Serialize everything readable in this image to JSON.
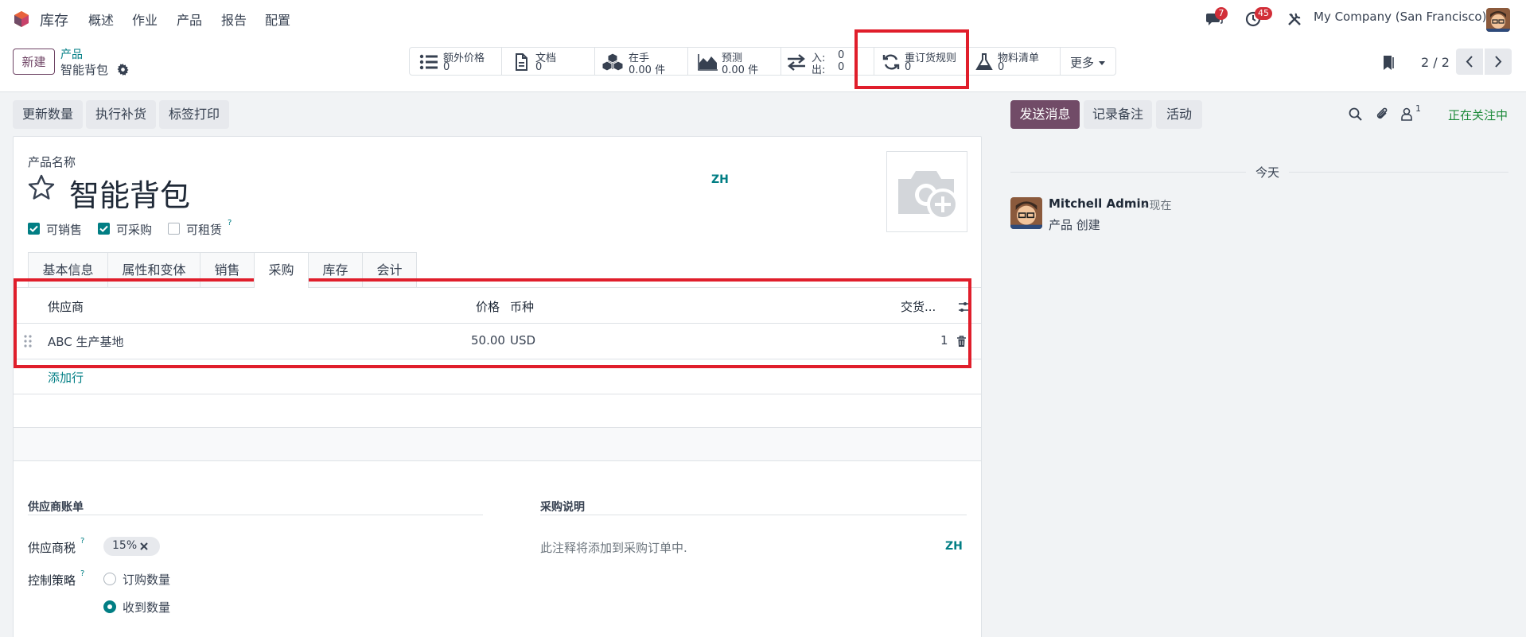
{
  "topnav": {
    "brand": "库存",
    "menu": [
      "概述",
      "作业",
      "产品",
      "报告",
      "配置"
    ],
    "messages_count": "7",
    "activities_count": "45",
    "company": "My Company (San Francisco)"
  },
  "control": {
    "new_button": "新建",
    "breadcrumb_parent": "产品",
    "breadcrumb_current": "智能背包",
    "pager": "2 / 2",
    "smart_buttons": [
      {
        "label": "额外价格",
        "value": "0"
      },
      {
        "label": "文档",
        "value": "0"
      },
      {
        "label": "在手",
        "value": "0.00 件"
      },
      {
        "label": "预测",
        "value": "0.00 件"
      },
      {
        "label_in": "入:",
        "value_in": "0",
        "label_out": "出:",
        "value_out": "0"
      },
      {
        "label": "重订货规则",
        "value": "0"
      },
      {
        "label": "物料清单",
        "value": "0"
      }
    ],
    "more_label": "更多"
  },
  "actions": {
    "update_qty": "更新数量",
    "replenish": "执行补货",
    "print_labels": "标签打印"
  },
  "form": {
    "product_name_label": "产品名称",
    "product_name": "智能背包",
    "lang_badge": "ZH",
    "checks": [
      {
        "label": "可销售",
        "checked": true
      },
      {
        "label": "可采购",
        "checked": true
      },
      {
        "label": "可租赁",
        "checked": false
      }
    ],
    "help_mark": "?",
    "tabs": [
      "基本信息",
      "属性和变体",
      "销售",
      "采购",
      "库存",
      "会计"
    ],
    "active_tab": "采购",
    "vendor_table": {
      "headers": [
        "供应商",
        "价格",
        "币种",
        "交货..."
      ],
      "rows": [
        {
          "vendor": "ABC 生产基地",
          "price": "50.00",
          "currency": "USD",
          "delivery": "1"
        }
      ],
      "add_line": "添加行"
    },
    "vendor_bills_title": "供应商账单",
    "vendor_taxes_label": "供应商税",
    "vendor_tax_tag": "15%",
    "control_policy_label": "控制策略",
    "policy_options": [
      {
        "label": "订购数量",
        "selected": false
      },
      {
        "label": "收到数量",
        "selected": true
      }
    ],
    "purchase_desc_title": "采购说明",
    "purchase_desc_placeholder": "此注释将添加到采购订单中.",
    "purchase_desc_lang": "ZH"
  },
  "chatter": {
    "send_message": "发送消息",
    "log_note": "记录备注",
    "activity": "活动",
    "followers_count": "1",
    "following": "正在关注中",
    "day_separator": "今天",
    "message": {
      "author": "Mitchell Admin",
      "time": "- 现在",
      "body": "产品 创建"
    }
  },
  "colors": {
    "brand": "#6f4565",
    "teal": "#017e84",
    "highlight": "#e01e2b",
    "following": "#1d8a3a"
  }
}
